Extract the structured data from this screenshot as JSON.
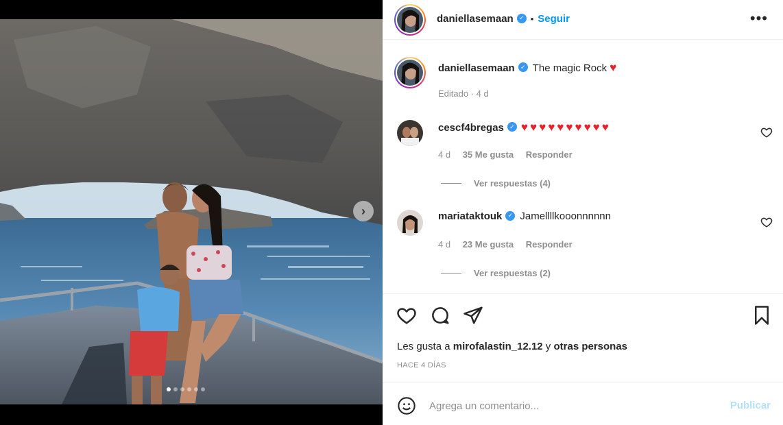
{
  "post": {
    "author": "daniellasemaan",
    "follow_label": "Seguir",
    "more_label": "•••",
    "caption": "The magic Rock",
    "caption_emoji": "♥",
    "edited_label": "Editado · 4 d",
    "carousel": {
      "total": 6,
      "active_index": 0,
      "next_label": "›"
    }
  },
  "comments": [
    {
      "username": "cescf4bregas",
      "text": "♥♥♥♥♥♥♥♥♥♥",
      "age": "4 d",
      "likes": "35 Me gusta",
      "reply_label": "Responder",
      "view_replies": "Ver respuestas (4)"
    },
    {
      "username": "mariataktouk",
      "text": "Jamellllkooonnnnnn",
      "age": "4 d",
      "likes": "23 Me gusta",
      "reply_label": "Responder",
      "view_replies": "Ver respuestas (2)"
    }
  ],
  "engagement": {
    "likes_prefix": "Les gusta a ",
    "liked_by": "mirofalastin_12.12",
    "likes_joiner": " y ",
    "likes_suffix": "otras personas",
    "timestamp": "HACE 4 DÍAS"
  },
  "composer": {
    "placeholder": "Agrega un comentario...",
    "publish_label": "Publicar"
  },
  "colors": {
    "link_blue": "#0095f6",
    "publish_disabled": "#b2dffc",
    "verified": "#3897f0",
    "heart_red": "#e3242b",
    "muted": "#8e8e8e"
  },
  "icons": [
    "verified-badge-icon",
    "heart-icon",
    "comment-icon",
    "share-icon",
    "bookmark-icon",
    "emoji-icon",
    "chevron-right-icon"
  ]
}
